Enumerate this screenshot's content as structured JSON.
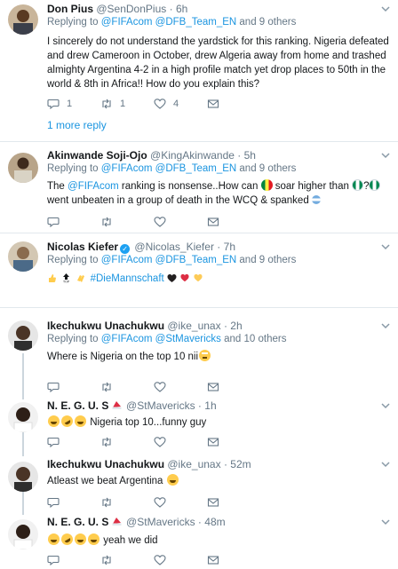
{
  "tweets": [
    {
      "name": "Don Pius",
      "handle": "@SenDonPius",
      "sep": "·",
      "time": "6h",
      "replying_prefix": "Replying to",
      "mention_1": "@FIFAcom",
      "mention_2": "@DFB_Team_EN",
      "replying_suffix": "and 9 others",
      "text": "I sincerely do not understand the yardstick for this ranking. Nigeria defeated and drew Cameroon in October, drew Algeria away from home and trashed almighty Argentina 4-2 in a high profile match yet drop places to 50th in the world & 8th in Africa!! How do you explain this?",
      "reply_count": "1",
      "retweet_count": "1",
      "like_count": "4",
      "more_replies": "1 more reply"
    },
    {
      "name": "Akinwande Soji-Ojo",
      "handle": "@KingAkinwande",
      "sep": "·",
      "time": "5h",
      "replying_prefix": "Replying to",
      "mention_1": "@FIFAcom",
      "mention_2": "@DFB_Team_EN",
      "replying_suffix": "and 9 others",
      "text_pre": "The",
      "text_mention": "@FIFAcom",
      "text_mid": "ranking is nonsense..How can",
      "text_mid2": "soar higher than",
      "text_q": "?",
      "text_post": "went unbeaten in a group of death in the WCQ & spanked",
      "reply_count": "",
      "retweet_count": "",
      "like_count": ""
    },
    {
      "name": "Nicolas Kiefer",
      "verified": true,
      "handle": "@Nicolas_Kiefer",
      "sep": "·",
      "time": "7h",
      "replying_prefix": "Replying to",
      "mention_1": "@FIFAcom",
      "mention_2": "@DFB_Team_EN",
      "replying_suffix": "and 9 others",
      "hashtag": "#DieMannschaft",
      "reply_count": "",
      "retweet_count": "",
      "like_count": ""
    },
    {
      "name": "Ikechukwu Unachukwu",
      "handle": "@ike_unax",
      "sep": "·",
      "time": "2h",
      "replying_prefix": "Replying to",
      "mention_1": "@FIFAcom",
      "mention_2": "@StMavericks",
      "replying_suffix": "and 10 others",
      "text": "Where is Nigeria on the top 10 nii",
      "reply_count": "",
      "retweet_count": "",
      "like_count": ""
    },
    {
      "name": "N. E. G. U. S",
      "handle": "@StMavericks",
      "sep": "·",
      "time": "1h",
      "text": "Nigeria top 10...funny guy",
      "reply_count": "",
      "retweet_count": "",
      "like_count": ""
    },
    {
      "name": "Ikechukwu Unachukwu",
      "handle": "@ike_unax",
      "sep": "·",
      "time": "52m",
      "text": "Atleast we beat Argentina",
      "reply_count": "",
      "retweet_count": "",
      "like_count": ""
    },
    {
      "name": "N. E. G. U. S",
      "handle": "@StMavericks",
      "sep": "·",
      "time": "48m",
      "text": "yeah we did",
      "reply_count": "",
      "retweet_count": "",
      "like_count": ""
    }
  ],
  "icons": {
    "reply": "reply-icon",
    "retweet": "retweet-icon",
    "like": "heart-icon",
    "message": "envelope-icon",
    "more": "chevron-down-icon"
  },
  "colors": {
    "link": "#1b95e0",
    "muted": "#657786",
    "text": "#14171a",
    "divider": "#e1e8ed",
    "verified": "#1da1f2"
  }
}
